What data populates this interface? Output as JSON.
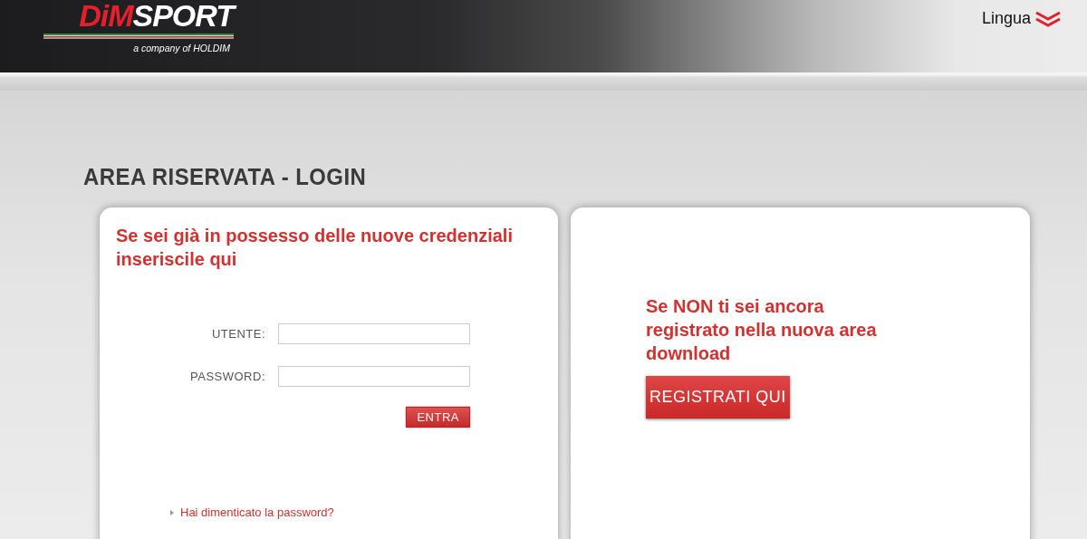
{
  "header": {
    "logo": {
      "mark_left": "DiM",
      "mark_right": "SPORT",
      "tagline": "a company of HOLDIM"
    },
    "language": {
      "label": "Lingua"
    }
  },
  "page_title": "AREA RISERVATA - LOGIN",
  "login_card": {
    "heading": "Se sei già in possesso delle nuove credenziali inseriscile qui",
    "fields": [
      {
        "label": "UTENTE:"
      },
      {
        "label": "PASSWORD:"
      }
    ],
    "submit": "ENTRA",
    "forgot_link": "Hai dimenticato la password?"
  },
  "register_card": {
    "heading": "Se NON ti sei ancora registrato nella nuova area download",
    "button": "REGISTRATI QUI"
  }
}
